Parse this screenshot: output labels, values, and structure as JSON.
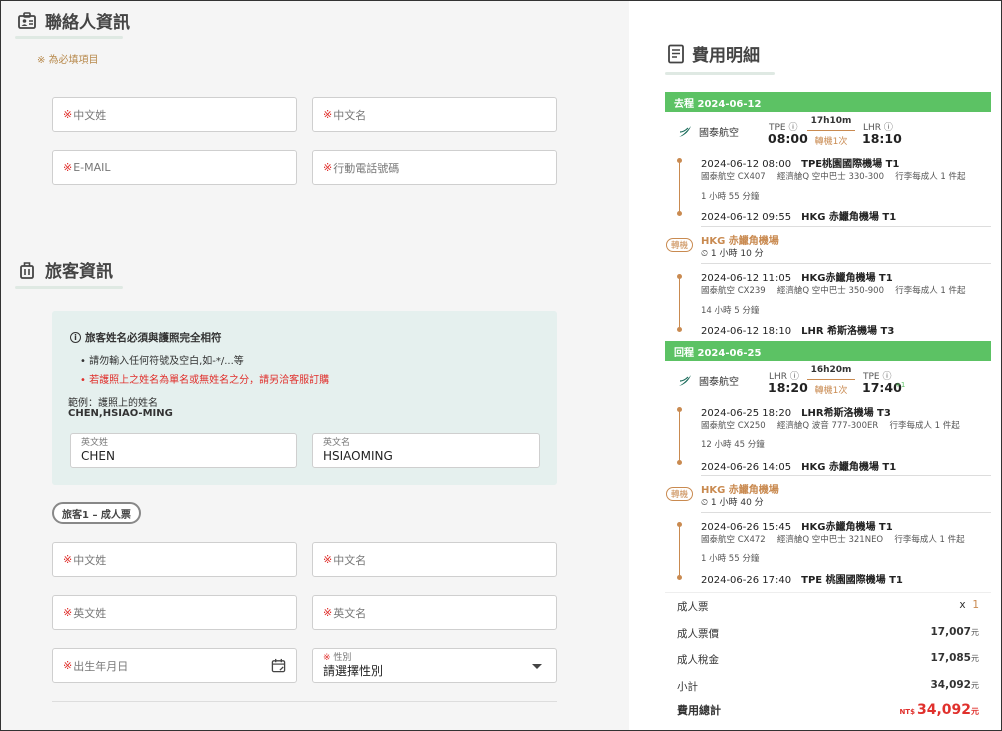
{
  "contact": {
    "title": "聯絡人資訊",
    "required_note": "※ 為必填項目",
    "fields": {
      "last_name_cn": "中文姓",
      "first_name_cn": "中文名",
      "email": "E-MAIL",
      "mobile": "行動電話號碼"
    },
    "required_mark": "※"
  },
  "traveler": {
    "title": "旅客資訊",
    "notice": {
      "heading": "旅客姓名必須與護照完全相符",
      "bullet1": "請勿輸入任何符號及空白,如-*/...等",
      "bullet2": "若護照上之姓名為單名或無姓名之分，請另洽客服訂購",
      "example_label": "範例：護照上的姓名",
      "example_value": "CHEN,HSIAO-MING",
      "sample_last_label": "英文姓",
      "sample_last_value": "CHEN",
      "sample_first_label": "英文名",
      "sample_first_value": "HSIAOMING"
    },
    "pill": "旅客1 – 成人票",
    "fields": {
      "last_name_cn": "中文姓",
      "first_name_cn": "中文名",
      "last_name_en": "英文姓",
      "first_name_en": "英文名",
      "birthday": "出生年月日",
      "gender_label": "性別",
      "gender_value": "請選擇性別"
    }
  },
  "fare": {
    "title": "費用明細",
    "outbound": {
      "bar": "去程 2024-06-12",
      "airline": "國泰航空",
      "dep_code": "TPE",
      "dep_time": "08:00",
      "arr_code": "LHR",
      "arr_time": "18:10",
      "duration": "17h10m",
      "stops": "轉機1次",
      "seg1": {
        "dep": "2024-06-12 08:00",
        "dep_apt": "TPE桃園國際機場 T1",
        "info": "國泰航空 CX407　 經濟艙Q 空中巴士 330-300　 行李每成人 1 件起",
        "dur": "1 小時 55 分鐘",
        "arr": "2024-06-12 09:55",
        "arr_apt": "HKG 赤鱲角機場 T1"
      },
      "transfer": {
        "badge": "轉機",
        "apt": "HKG 赤鱲角機場",
        "wait": "1 小時 10 分"
      },
      "seg2": {
        "dep": "2024-06-12 11:05",
        "dep_apt": "HKG赤鱲角機場 T1",
        "info": "國泰航空 CX239　 經濟艙Q 空中巴士 350-900　 行李每成人 1 件起",
        "dur": "14 小時 5 分鐘",
        "arr": "2024-06-12 18:10",
        "arr_apt": "LHR 希斯洛機場 T3"
      }
    },
    "inbound": {
      "bar": "回程 2024-06-25",
      "airline": "國泰航空",
      "dep_code": "LHR",
      "dep_time": "18:20",
      "arr_code": "TPE",
      "arr_time": "17:40",
      "plus_day": "+1",
      "duration": "16h20m",
      "stops": "轉機1次",
      "seg1": {
        "dep": "2024-06-25 18:20",
        "dep_apt": "LHR希斯洛機場 T3",
        "info": "國泰航空 CX250　 經濟艙Q 波音 777-300ER　 行李每成人 1 件起",
        "dur": "12 小時 45 分鐘",
        "arr": "2024-06-26 14:05",
        "arr_apt": "HKG 赤鱲角機場 T1"
      },
      "transfer": {
        "badge": "轉機",
        "apt": "HKG 赤鱲角機場",
        "wait": "1 小時 40 分"
      },
      "seg2": {
        "dep": "2024-06-26 15:45",
        "dep_apt": "HKG赤鱲角機場 T1",
        "info": "國泰航空 CX472　 經濟艙Q 空中巴士 321NEO　 行李每成人 1 件起",
        "dur": "1 小時 55 分鐘",
        "arr": "2024-06-26 17:40",
        "arr_apt": "TPE 桃園國際機場 T1"
      }
    },
    "summary": {
      "adult_label": "成人票",
      "adult_x": "x",
      "adult_count": "1",
      "fare_label": "成人票價",
      "fare_value": "17,007",
      "tax_label": "成人稅金",
      "tax_value": "17,085",
      "subtotal_label": "小計",
      "subtotal_value": "34,092",
      "total_label": "費用總計",
      "currency": "NT$",
      "total_value": "34,092",
      "unit": "元"
    }
  },
  "colors": {
    "green_bar": "#5cc264",
    "accent_brown": "#c98a50",
    "required_red": "#e0302c",
    "notice_bg": "#e5f0ee"
  }
}
